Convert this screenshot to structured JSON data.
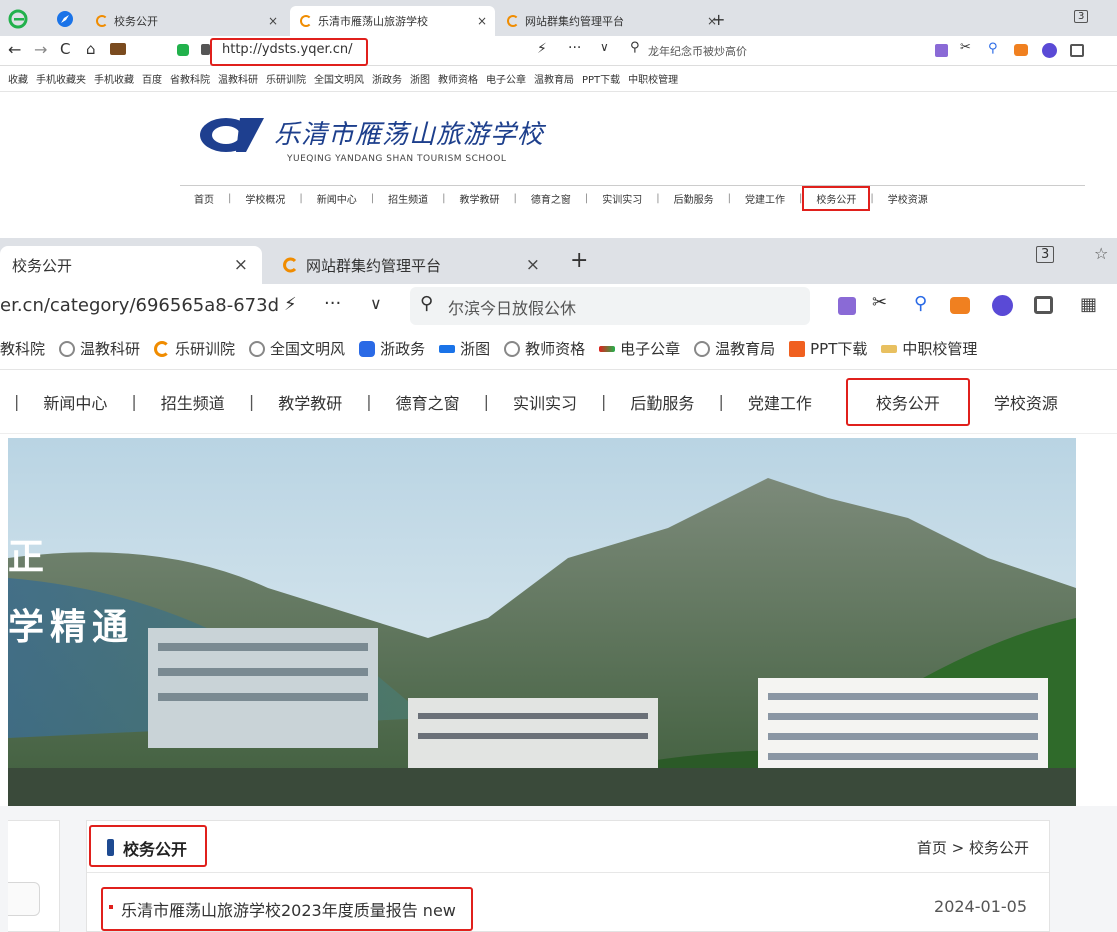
{
  "colors": {
    "accent_red": "#e0201c",
    "school_blue": "#1e4a91",
    "tab_bg": "#dee1e6"
  },
  "small": {
    "tabs": [
      {
        "label": "校务公开",
        "icon": "site-favicon"
      },
      {
        "label": "乐清市雁荡山旅游学校",
        "icon": "site-favicon"
      },
      {
        "label": "网站群集约管理平台",
        "icon": "site-favicon"
      }
    ],
    "tab_count": "3",
    "url": "http://ydsts.yqer.cn/",
    "search_placeholder": "龙年纪念币被炒高价",
    "bookmarks": [
      "收藏",
      "手机收藏夹",
      "手机收藏",
      "百度",
      "省教科院",
      "温教科研",
      "乐研训院",
      "全国文明风",
      "浙政务",
      "浙图",
      "教师资格",
      "电子公章",
      "温教育局",
      "PPT下载",
      "中职校管理"
    ],
    "school_name_cn": "乐清市雁荡山旅游学校",
    "school_name_en": "YUEQING YANDANG SHAN TOURISM SCHOOL",
    "nav": [
      "首页",
      "学校概况",
      "新闻中心",
      "招生频道",
      "教学教研",
      "德育之窗",
      "实训实习",
      "后勤服务",
      "党建工作",
      "校务公开",
      "学校资源"
    ]
  },
  "zoom": {
    "tabs": [
      {
        "label": "校务公开"
      },
      {
        "label": "网站群集约管理平台"
      }
    ],
    "tab_count": "3",
    "url": "er.cn/category/696565a8-673d",
    "search_placeholder": "尔滨今日放假公休",
    "bookmarks": [
      "教科院",
      "温教科研",
      "乐研训院",
      "全国文明风",
      "浙政务",
      "浙图",
      "教师资格",
      "电子公章",
      "温教育局",
      "PPT下载",
      "中职校管理"
    ],
    "nav": [
      "新闻中心",
      "招生频道",
      "教学教研",
      "德育之窗",
      "实训实习",
      "后勤服务",
      "党建工作",
      "校务公开",
      "学校资源"
    ],
    "banner_slogan_1": "正",
    "banner_slogan_2": "学精通",
    "section_title": "校务公开",
    "breadcrumb": "首页 > 校务公开",
    "articles": [
      {
        "title": "乐清市雁荡山旅游学校2023年度质量报告 new",
        "date": "2024-01-05"
      }
    ]
  }
}
